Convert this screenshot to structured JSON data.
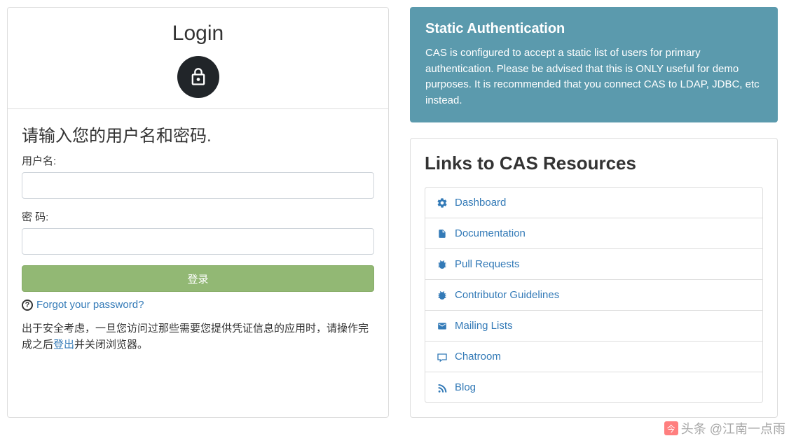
{
  "login": {
    "title": "Login",
    "form_title": "请输入您的用户名和密码.",
    "username_label": "用户名:",
    "password_label": "密  码:",
    "submit_label": "登录",
    "forgot_label": "Forgot your password?",
    "notice_before": "出于安全考虑，一旦您访问过那些需要您提供凭证信息的应用时，请操作完成之后",
    "notice_link": "登出",
    "notice_after": "并关闭浏览器。"
  },
  "alert": {
    "title": "Static Authentication",
    "text": "CAS is configured to accept a static list of users for primary authentication. Please be advised that this is ONLY useful for demo purposes. It is recommended that you connect CAS to LDAP, JDBC, etc instead."
  },
  "resources": {
    "title": "Links to CAS Resources",
    "items": [
      {
        "label": "Dashboard",
        "icon": "cogs-icon"
      },
      {
        "label": "Documentation",
        "icon": "file-icon"
      },
      {
        "label": "Pull Requests",
        "icon": "bug-icon"
      },
      {
        "label": "Contributor Guidelines",
        "icon": "bug-icon"
      },
      {
        "label": "Mailing Lists",
        "icon": "envelope-icon"
      },
      {
        "label": "Chatroom",
        "icon": "chat-icon"
      },
      {
        "label": "Blog",
        "icon": "rss-icon"
      }
    ]
  },
  "watermark": {
    "text": "头条 @江南一点雨"
  }
}
